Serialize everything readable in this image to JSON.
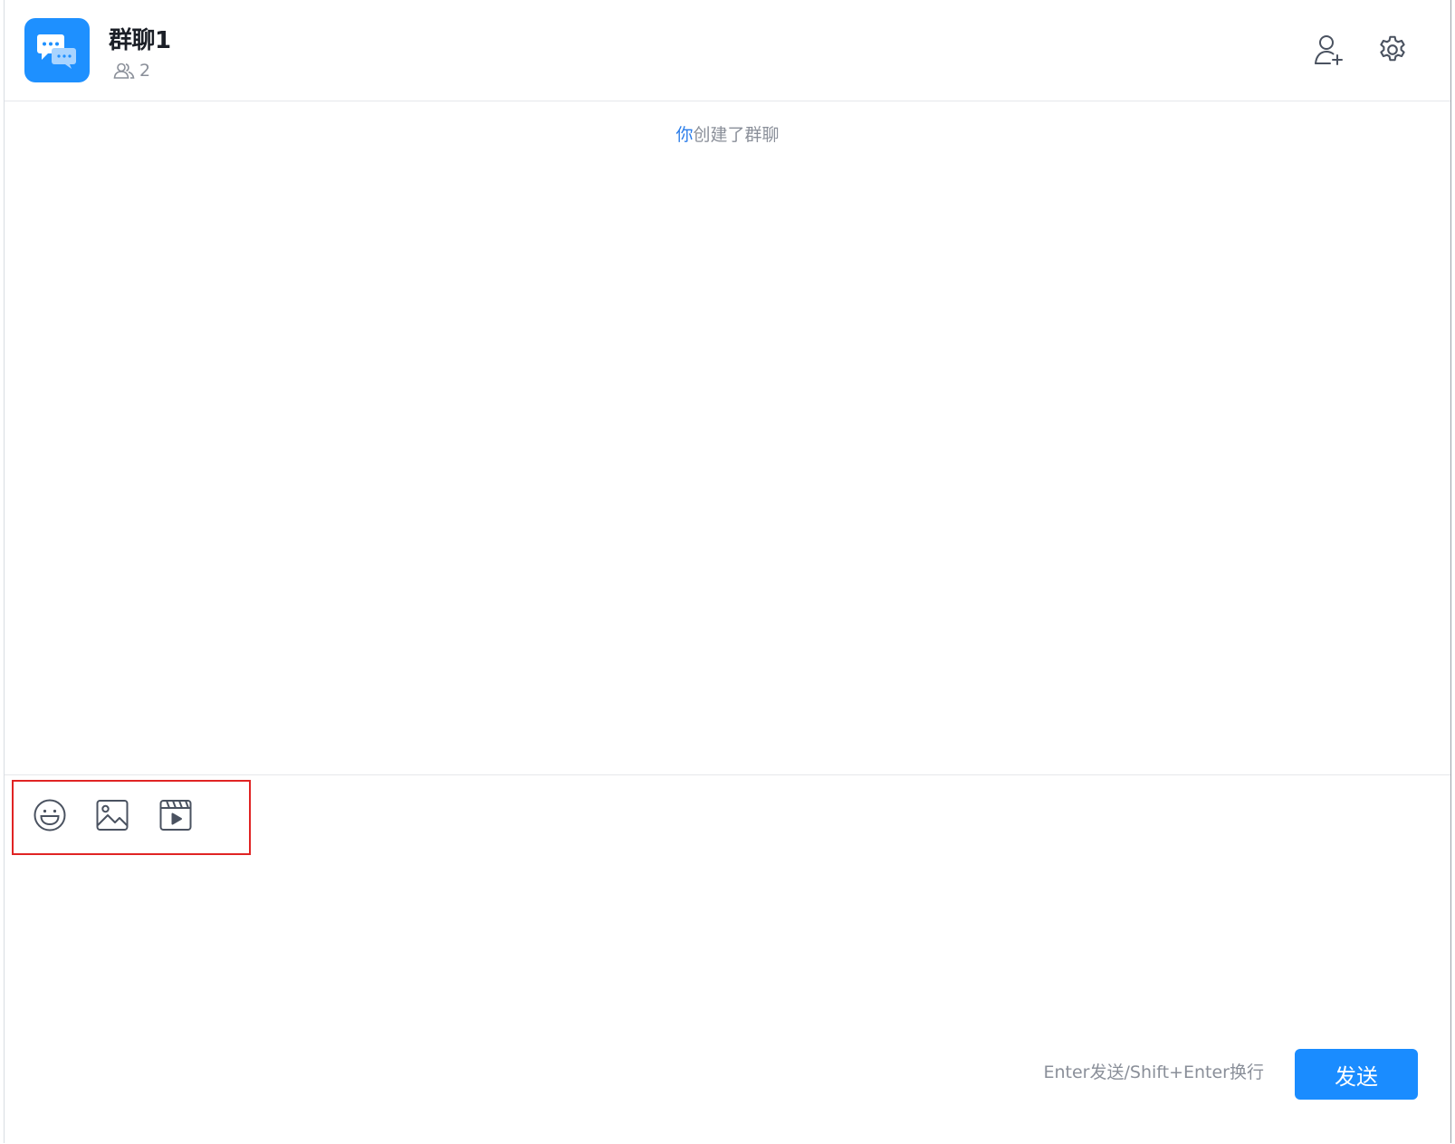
{
  "header": {
    "group_name": "群聊1",
    "member_count": "2",
    "avatar_icon": "group-chat-bubbles-icon",
    "add_member_icon": "add-user-icon",
    "settings_icon": "gear-icon"
  },
  "messages": {
    "system": {
      "actor": "你",
      "text": "创建了群聊"
    }
  },
  "composer": {
    "tools": [
      {
        "name": "emoji",
        "icon": "smiley-icon"
      },
      {
        "name": "image",
        "icon": "image-icon"
      },
      {
        "name": "video",
        "icon": "video-icon"
      }
    ],
    "input_value": "",
    "hint": "Enter发送/Shift+Enter换行",
    "send_label": "发送"
  },
  "colors": {
    "accent": "#1a8cff",
    "avatar_bg": "#1e90ff",
    "actor_link": "#2b7de9",
    "highlight_box": "#e02424",
    "muted_text": "#8a8f99",
    "icon_stroke": "#4a5260"
  }
}
